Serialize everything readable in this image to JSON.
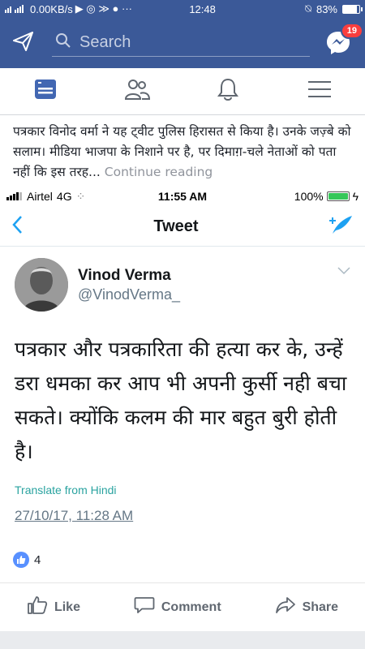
{
  "statusbar": {
    "network": "0.00KB/s",
    "time": "12:48",
    "battery": "83%",
    "battery_level": 0.83
  },
  "header": {
    "search_placeholder": "Search",
    "messenger_badge": "19"
  },
  "tabs": [
    "news-feed",
    "friends",
    "notifications",
    "menu"
  ],
  "post": {
    "text": "पत्रकार विनोद वर्मा ने यह ट्वीट पुलिस हिरासत से किया है। उनके जज़्बे को सलाम। मीडिया भाजपा के निशाने पर है, पर दिमाग़-चले नेताओं को पता नहीं कि इस तरह...",
    "more": "Continue reading"
  },
  "screenshot": {
    "carrier": "Airtel",
    "network": "4G",
    "time": "11:55 AM",
    "battery": "100%",
    "title": "Tweet",
    "author_name": "Vinod Verma",
    "author_handle": "@VinodVerma_",
    "tweet_text": "पत्रकार और पत्रकारिता की हत्या कर के, उन्हें डरा धमका कर आप भी अपनी कुर्सी नही बचा सकते। क्योंकि कलम की मार बहुत बुरी होती है।",
    "translate": "Translate from Hindi",
    "date": "27/10/17, 11:28 AM"
  },
  "reactions": {
    "count": "4"
  },
  "actions": {
    "like": "Like",
    "comment": "Comment",
    "share": "Share"
  }
}
